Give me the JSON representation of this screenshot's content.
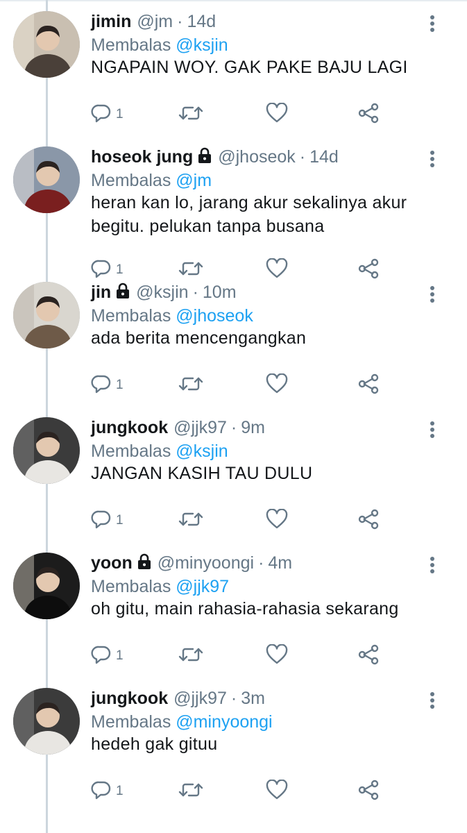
{
  "tweets": [
    {
      "name": "jimin",
      "locked": false,
      "handle": "@jm",
      "sep": "·",
      "time": "14d",
      "reply_prefix": "Membalas",
      "reply_to": "@ksjin",
      "text": "NGAPAIN WOY. GAK PAKE BAJU LAGI",
      "reply_count": "1",
      "avatar_palette": [
        "#c9bfb1",
        "#4a4039",
        "#efe8dc"
      ]
    },
    {
      "name": "hoseok jung",
      "locked": true,
      "handle": "@jhoseok",
      "sep": "·",
      "time": "14d",
      "reply_prefix": "Membalas",
      "reply_to": "@jm",
      "text": "heran kan lo, jarang akur sekalinya akur begitu. pelukan tanpa busana",
      "reply_count": "1",
      "avatar_palette": [
        "#8a97a8",
        "#7a1f1f",
        "#f1ece6"
      ]
    },
    {
      "name": "jin",
      "locked": true,
      "handle": "@ksjin",
      "sep": "·",
      "time": "10m",
      "reply_prefix": "Membalas",
      "reply_to": "@jhoseok",
      "text": "ada berita mencengangkan",
      "reply_count": "1",
      "avatar_palette": [
        "#d9d6cf",
        "#6e5a48",
        "#b9b2a6"
      ]
    },
    {
      "name": "jungkook",
      "locked": false,
      "handle": "@jjk97",
      "sep": "·",
      "time": "9m",
      "reply_prefix": "Membalas",
      "reply_to": "@ksjin",
      "text": "JANGAN KASIH TAU DULU",
      "reply_count": "1",
      "avatar_palette": [
        "#3b3b3b",
        "#e8e6e2",
        "#8d8d8d"
      ]
    },
    {
      "name": "yoon",
      "locked": true,
      "handle": "@minyoongi",
      "sep": "·",
      "time": "4m",
      "reply_prefix": "Membalas",
      "reply_to": "@jjk97",
      "text": "oh gitu, main rahasia-rahasia sekarang",
      "reply_count": "1",
      "avatar_palette": [
        "#1c1c1c",
        "#0d0d0d",
        "#d8d0c4"
      ]
    },
    {
      "name": "jungkook",
      "locked": false,
      "handle": "@jjk97",
      "sep": "·",
      "time": "3m",
      "reply_prefix": "Membalas",
      "reply_to": "@minyoongi",
      "text": "hedeh gak gituu",
      "reply_count": "1",
      "avatar_palette": [
        "#3b3b3b",
        "#e8e6e2",
        "#8d8d8d"
      ]
    }
  ],
  "icons": {
    "reply": "reply-icon",
    "retweet": "retweet-icon",
    "like": "heart-icon",
    "share": "share-icon",
    "more": "more-vertical-icon",
    "lock": "lock-icon"
  },
  "colors": {
    "text": "#14171a",
    "muted": "#657786",
    "link": "#1da1f2",
    "thread_line": "#ccd6dd",
    "background": "#ffffff"
  }
}
